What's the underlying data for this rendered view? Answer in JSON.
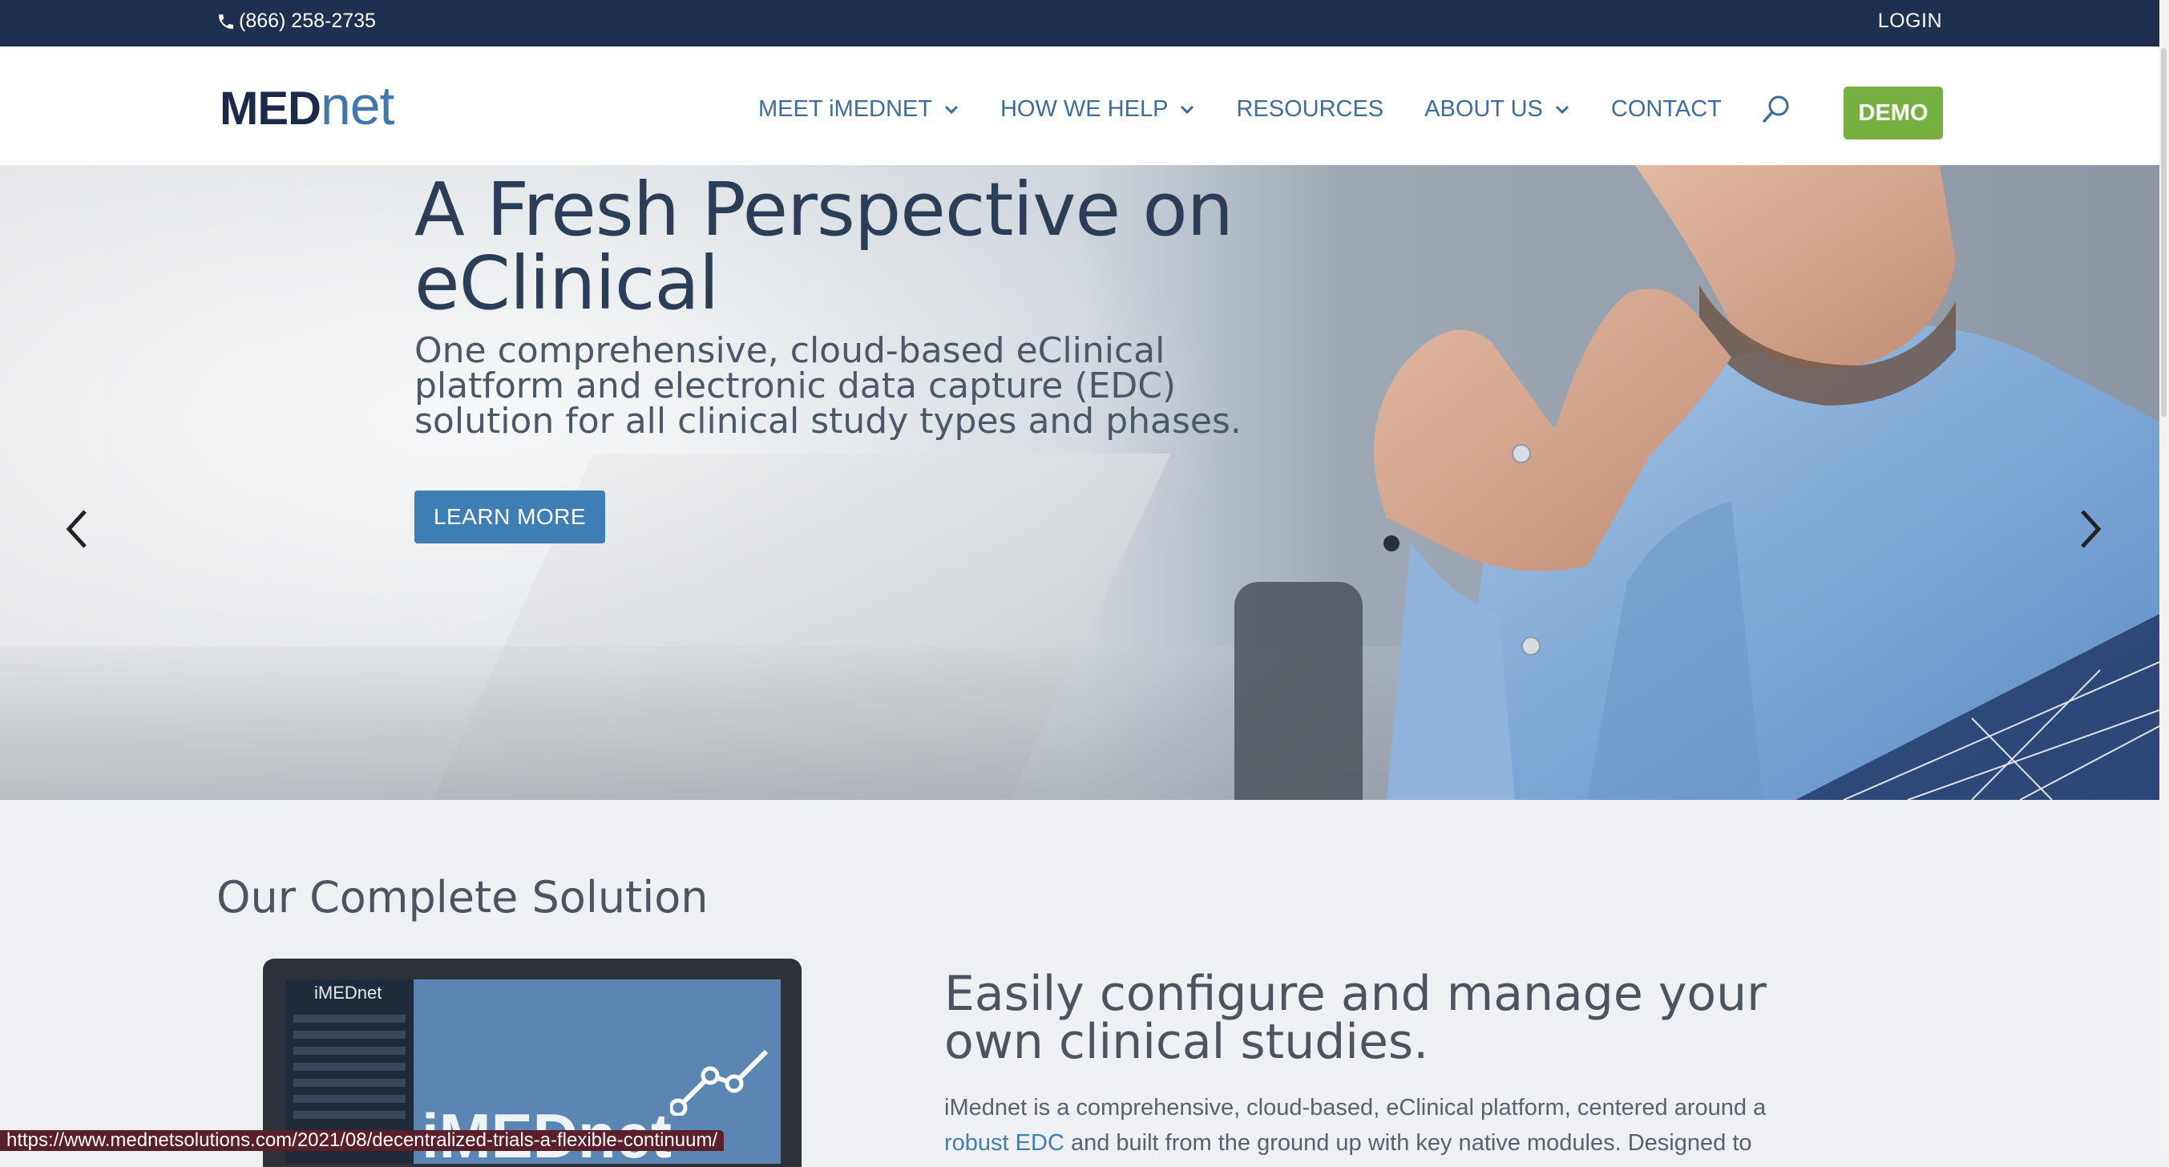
{
  "topbar": {
    "phone": "(866) 258-2735",
    "login": "LOGIN"
  },
  "header": {
    "logo_med": "MED",
    "logo_net": "net",
    "nav": [
      {
        "label": "MEET iMEDNET",
        "dropdown": true
      },
      {
        "label": "HOW WE HELP",
        "dropdown": true
      },
      {
        "label": "RESOURCES",
        "dropdown": false
      },
      {
        "label": "ABOUT US",
        "dropdown": true
      },
      {
        "label": "CONTACT",
        "dropdown": false
      }
    ],
    "demo": "DEMO"
  },
  "hero": {
    "title": "A Fresh Perspective on eClinical",
    "subtitle": "One comprehensive, cloud-based eClinical platform and electronic data capture (EDC) solution for all clinical study types and phases.",
    "button": "LEARN MORE",
    "slides": 2,
    "active_slide": 1
  },
  "solution": {
    "title": "Our Complete Solution",
    "screen_app": "iMEDnet",
    "screen_brand": "iMEDnet",
    "headline": "Easily configure and manage your own clinical studies.",
    "para_before_link": "iMednet is a comprehensive, cloud-based, eClinical platform, centered around a ",
    "para_link": "robust EDC",
    "para_after_link": " and built from the ground up with key native modules. Designed to"
  },
  "status_url": "https://www.mednetsolutions.com/2021/08/decentralized-trials-a-flexible-continuum/",
  "colors": {
    "navy": "#1e304f",
    "nav_blue": "#3c6d9e",
    "green": "#76b041",
    "button_blue": "#3f7db5"
  }
}
